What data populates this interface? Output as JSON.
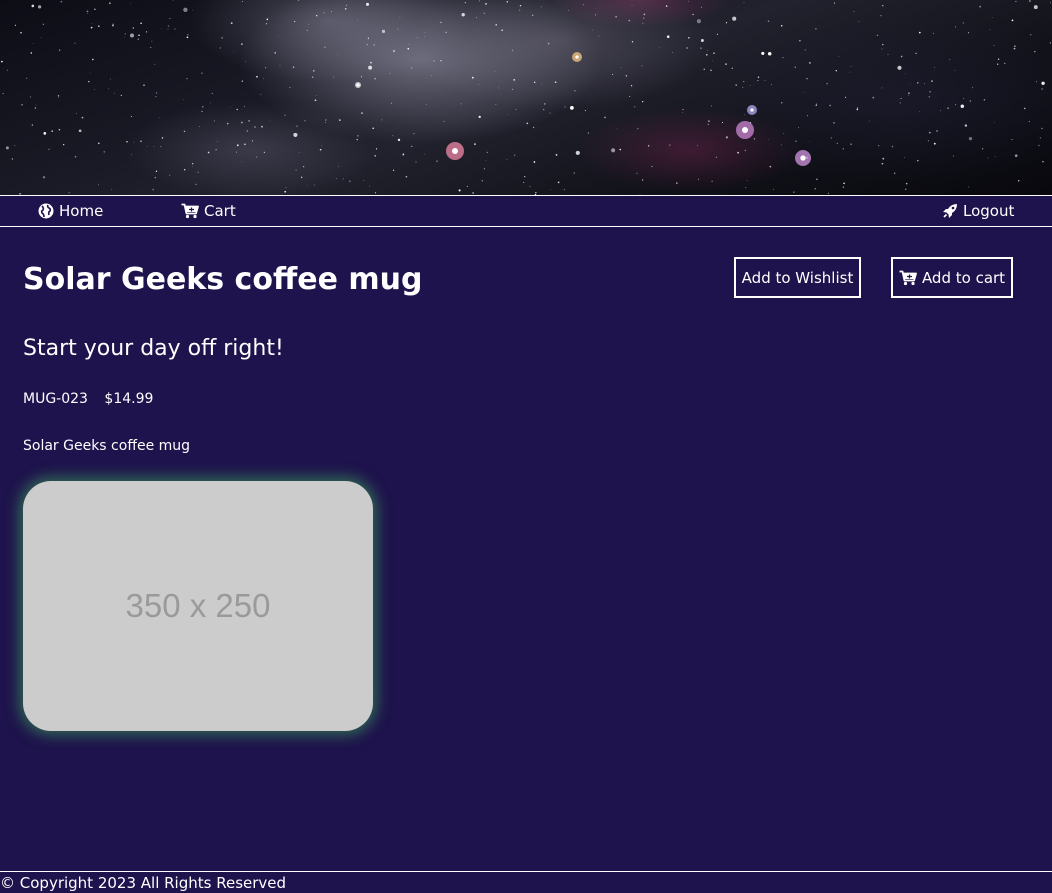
{
  "nav": {
    "home": {
      "label": "Home",
      "icon": "globe-icon"
    },
    "cart": {
      "label": "Cart",
      "icon": "cart-icon"
    },
    "logout": {
      "label": "Logout",
      "icon": "rocket-icon"
    }
  },
  "product": {
    "title": "Solar Geeks coffee mug",
    "tagline": "Start your day off right!",
    "sku": "MUG-023",
    "price": "$14.99",
    "description": "Solar Geeks coffee mug",
    "image_placeholder": "350 x 250"
  },
  "actions": {
    "wishlist_label": "Add to Wishlist",
    "cart_label": "Add to cart",
    "cart_icon": "cart-plus-icon"
  },
  "footer": {
    "copyright": "© Copyright 2023 All Rights Reserved"
  },
  "colors": {
    "background": "#1e134c",
    "text": "#ffffff",
    "image_glow": "#3ca05a",
    "placeholder_bg": "#cccccc"
  }
}
